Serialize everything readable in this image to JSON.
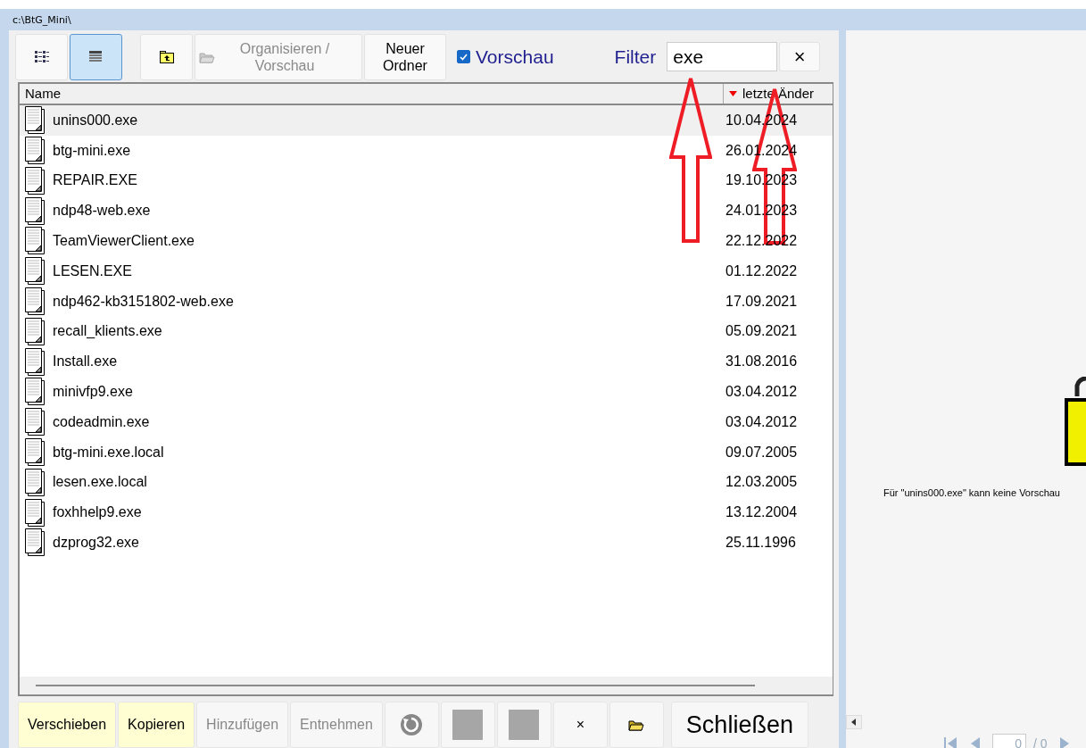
{
  "window": {
    "title": "c:\\BtG_Mini\\"
  },
  "toolbar": {
    "view_buttons": [
      {
        "kind": "list",
        "selected": false
      },
      {
        "kind": "details",
        "selected": true
      }
    ],
    "organize_button": {
      "label": "Organisieren / Vorschau",
      "disabled": true
    },
    "new_folder_button": {
      "label": "Neuer Ordner"
    },
    "preview_checkbox": {
      "label": "Vorschau",
      "checked": true
    },
    "filter": {
      "label": "Filter",
      "value": "exe"
    },
    "clear_button": {
      "label": "×"
    }
  },
  "table": {
    "columns": [
      {
        "label": "Name"
      },
      {
        "label": "letzte Änder",
        "sorted_descending": true
      }
    ],
    "rows": [
      {
        "name": "unins000.exe",
        "date": "10.04.2024",
        "selected": true
      },
      {
        "name": "btg-mini.exe",
        "date": "26.01.2024",
        "selected": false
      },
      {
        "name": "REPAIR.EXE",
        "date": "19.10.2023",
        "selected": false
      },
      {
        "name": "ndp48-web.exe",
        "date": "24.01.2023",
        "selected": false
      },
      {
        "name": "TeamViewerClient.exe",
        "date": "22.12.2022",
        "selected": false
      },
      {
        "name": "LESEN.EXE",
        "date": "01.12.2022",
        "selected": false
      },
      {
        "name": "ndp462-kb3151802-web.exe",
        "date": "17.09.2021",
        "selected": false
      },
      {
        "name": "recall_klients.exe",
        "date": "05.09.2021",
        "selected": false
      },
      {
        "name": "Install.exe",
        "date": "31.08.2016",
        "selected": false
      },
      {
        "name": "minivfp9.exe",
        "date": "03.04.2012",
        "selected": false
      },
      {
        "name": "codeadmin.exe",
        "date": "03.04.2012",
        "selected": false
      },
      {
        "name": "btg-mini.exe.local",
        "date": "09.07.2005",
        "selected": false
      },
      {
        "name": "lesen.exe.local",
        "date": "12.03.2005",
        "selected": false
      },
      {
        "name": "foxhhelp9.exe",
        "date": "13.12.2004",
        "selected": false
      },
      {
        "name": "dzprog32.exe",
        "date": "25.11.1996",
        "selected": false
      }
    ]
  },
  "bottom_buttons": [
    {
      "kind": "text",
      "label": "Verschieben",
      "highlighted": true,
      "disabled": false
    },
    {
      "kind": "text",
      "label": "Kopieren",
      "highlighted": true,
      "disabled": false
    },
    {
      "kind": "text",
      "label": "Hinzufügen",
      "highlighted": false,
      "disabled": true
    },
    {
      "kind": "text",
      "label": "Entnehmen",
      "highlighted": false,
      "disabled": true
    },
    {
      "kind": "refresh"
    },
    {
      "kind": "square"
    },
    {
      "kind": "square"
    },
    {
      "kind": "text",
      "label": "×",
      "highlighted": false,
      "disabled": false
    },
    {
      "kind": "folder"
    },
    {
      "kind": "large",
      "label": "Schließen",
      "highlighted": false,
      "disabled": false
    }
  ],
  "preview": {
    "message": "Für \"unins000.exe\" kann keine Vorschau"
  },
  "pager": {
    "page": "0",
    "total": "/ 0"
  },
  "annotations": [
    {
      "kind": "up-arrow"
    },
    {
      "kind": "up-arrow"
    }
  ]
}
